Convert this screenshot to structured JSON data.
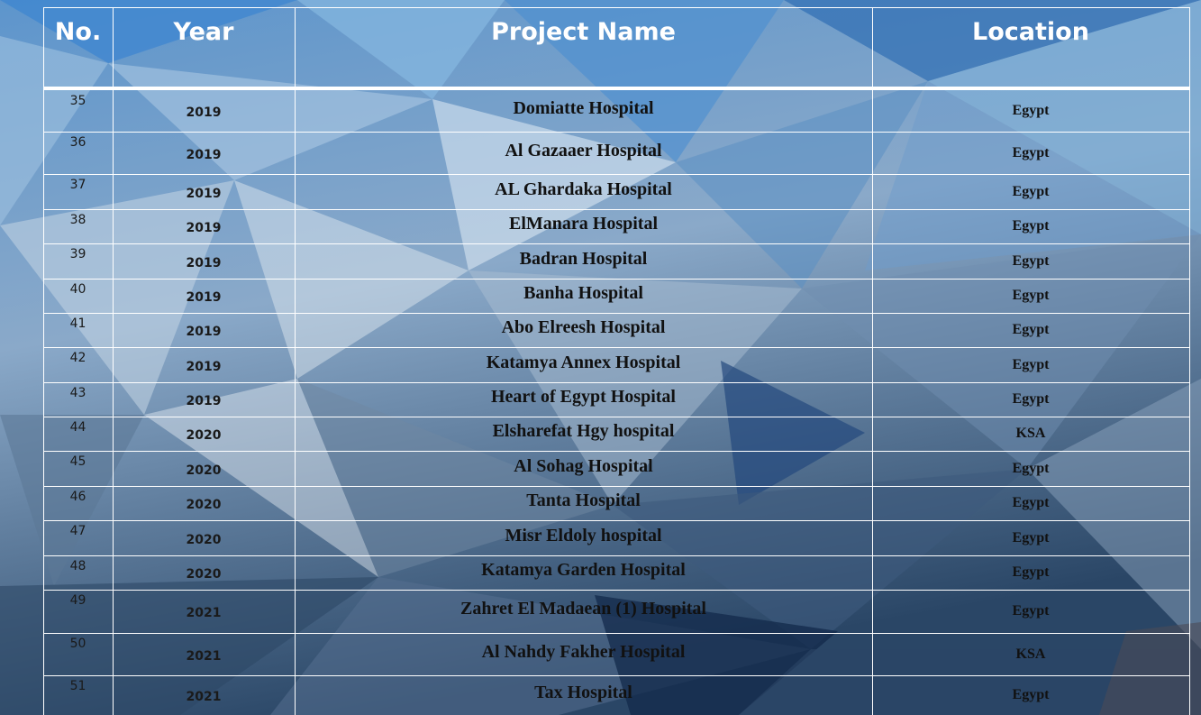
{
  "table": {
    "headers": {
      "no": "No.",
      "year": "Year",
      "project": "Project Name",
      "location": "Location"
    },
    "rows": [
      {
        "no": "35",
        "year": "2019",
        "project": "Domiatte Hospital",
        "location": "Egypt"
      },
      {
        "no": "36",
        "year": "2019",
        "project": "Al Gazaaer Hospital",
        "location": "Egypt"
      },
      {
        "no": "37",
        "year": "2019",
        "project": "AL Ghardaka Hospital",
        "location": "Egypt"
      },
      {
        "no": "38",
        "year": "2019",
        "project": "ElManara Hospital",
        "location": "Egypt"
      },
      {
        "no": "39",
        "year": "2019",
        "project": "Badran Hospital",
        "location": "Egypt"
      },
      {
        "no": "40",
        "year": "2019",
        "project": "Banha Hospital",
        "location": "Egypt"
      },
      {
        "no": "41",
        "year": "2019",
        "project": "Abo Elreesh Hospital",
        "location": "Egypt"
      },
      {
        "no": "42",
        "year": "2019",
        "project": "Katamya Annex Hospital",
        "location": "Egypt"
      },
      {
        "no": "43",
        "year": "2019",
        "project": "Heart of Egypt Hospital",
        "location": "Egypt"
      },
      {
        "no": "44",
        "year": "2020",
        "project": "Elsharefat Hgy hospital",
        "location": "KSA"
      },
      {
        "no": "45",
        "year": "2020",
        "project": "Al Sohag Hospital",
        "location": "Egypt"
      },
      {
        "no": "46",
        "year": "2020",
        "project": "Tanta Hospital",
        "location": "Egypt"
      },
      {
        "no": "47",
        "year": "2020",
        "project": "Misr Eldoly hospital",
        "location": "Egypt"
      },
      {
        "no": "48",
        "year": "2020",
        "project": "Katamya Garden Hospital",
        "location": "Egypt"
      },
      {
        "no": "49",
        "year": "2021",
        "project": "Zahret El Madaean (1) Hospital",
        "location": "Egypt"
      },
      {
        "no": "50",
        "year": "2021",
        "project": "Al Nahdy Fakher Hospital",
        "location": "KSA"
      },
      {
        "no": "51",
        "year": "2021",
        "project": "Tax Hospital",
        "location": "Egypt"
      }
    ]
  },
  "colors": {
    "line": "#ffffff",
    "header_text": "#ffffff",
    "bg_top": "#5d95cc",
    "bg_bottom": "#2a4666"
  }
}
